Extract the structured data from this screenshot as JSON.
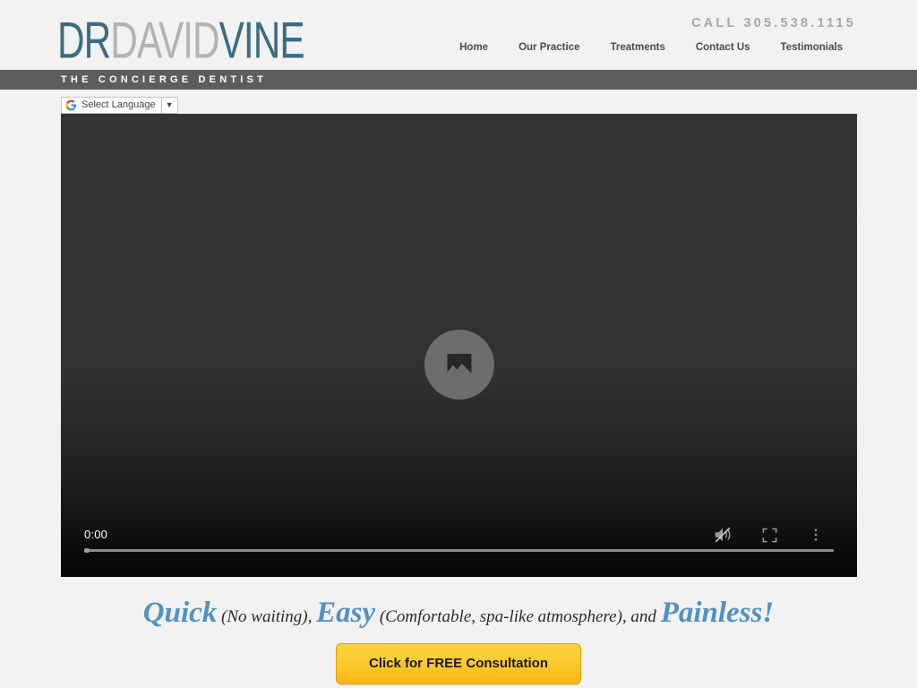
{
  "header": {
    "logo": {
      "part1": "DR",
      "part2": "DAVID",
      "part3": "VINE",
      "color_dark": "#3d6b80",
      "color_gray": "#b3b3b3"
    },
    "call_text": "CALL 305.538.1115",
    "nav": [
      {
        "label": "Home"
      },
      {
        "label": "Our Practice"
      },
      {
        "label": "Treatments"
      },
      {
        "label": "Contact Us"
      },
      {
        "label": "Testimonials"
      }
    ]
  },
  "concierge_bar": {
    "text": "THE CONCIERGE DENTIST",
    "background": "#5d5d5d"
  },
  "translate": {
    "icon": "google-g-icon",
    "label": "Select Language",
    "caret": "▼"
  },
  "video": {
    "poster_icon": "broken-image-placeholder-icon",
    "current_time": "0:00",
    "progress_percent": 0,
    "controls": [
      {
        "name": "mute-icon",
        "state": "muted"
      },
      {
        "name": "fullscreen-icon",
        "state": "off"
      },
      {
        "name": "more-options-icon",
        "state": "closed"
      }
    ]
  },
  "tagline": {
    "word1": "Quick",
    "note1": " (No waiting), ",
    "word2": "Easy",
    "note2": " (Comfortable, spa-like atmosphere), and ",
    "word3": "Painless!",
    "accent_color": "#5191c4"
  },
  "cta": {
    "text_before": "Click for ",
    "text_emphasis": "FREE",
    "text_after": " Consultation",
    "background_top": "#fbd23f",
    "background_bottom": "#f9b616"
  }
}
